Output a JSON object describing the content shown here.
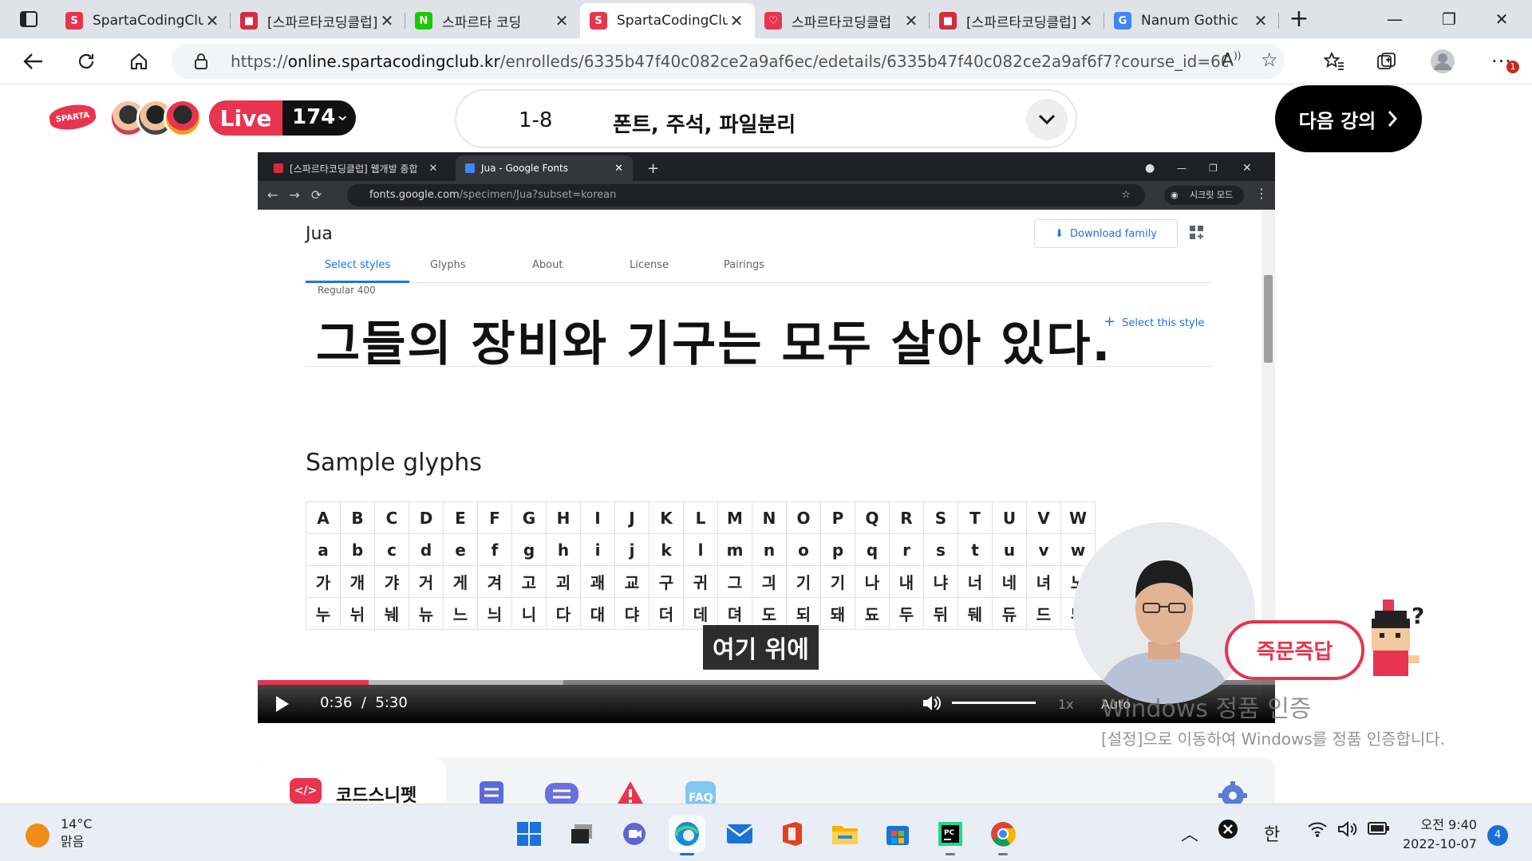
{
  "browser": {
    "tabs": [
      {
        "title": "SpartaCodingClub",
        "favicon_color": "#e8344e",
        "favicon_glyph": "S"
      },
      {
        "title": "[스파르타코딩클럽]",
        "favicon_color": "#d22d3d",
        "favicon_glyph": "■"
      },
      {
        "title": "스파르타 코딩",
        "favicon_color": "#1ec800",
        "favicon_glyph": "N"
      },
      {
        "title": "SpartaCodingClub",
        "favicon_color": "#e8344e",
        "favicon_glyph": "S"
      },
      {
        "title": "스파르타코딩클럽",
        "favicon_color": "#e8344e",
        "favicon_glyph": "♡"
      },
      {
        "title": "[스파르타코딩클럽]",
        "favicon_color": "#d22d3d",
        "favicon_glyph": "■"
      },
      {
        "title": "Nanum Gothic",
        "favicon_color": "#4285f4",
        "favicon_glyph": "G"
      }
    ],
    "active_tab_index": 3,
    "url_scheme": "https://",
    "url_host": "online.spartacodingclub.kr",
    "url_path": "/enrolleds/6335b47f40c082ce2a9af6ec/edetails/6335b47f40c082ce2a9af6f7?course_id=60a5ee42...",
    "menu_badge": "1"
  },
  "header": {
    "logo_text": "SPARTA",
    "live_label": "Live",
    "live_count": "174",
    "lesson_number": "1-8",
    "lesson_title": "폰트, 주석, 파일분리",
    "next_button": "다음 강의"
  },
  "video": {
    "inner_tabs": [
      {
        "title": "[스파르타코딩클럽] 웹개발 종합"
      },
      {
        "title": "Jua - Google Fonts"
      }
    ],
    "inner_url_host": "fonts.google.com",
    "inner_url_path": "/specimen/Jua?subset=korean",
    "incognito_label": "시크릿 모드",
    "gf": {
      "font_name": "Jua",
      "download_label": "Download family",
      "tabs": [
        "Select styles",
        "Glyphs",
        "About",
        "License",
        "Pairings"
      ],
      "style_label": "Regular 400",
      "specimen": "그들의 장비와 기구는 모두 살아 있다.",
      "select_style": "Select this style",
      "sample_glyphs_title": "Sample glyphs",
      "glyph_rows": [
        [
          "A",
          "B",
          "C",
          "D",
          "E",
          "F",
          "G",
          "H",
          "I",
          "J",
          "K",
          "L",
          "M",
          "N",
          "O",
          "P",
          "Q",
          "R",
          "S",
          "T",
          "U",
          "V",
          "W"
        ],
        [
          "a",
          "b",
          "c",
          "d",
          "e",
          "f",
          "g",
          "h",
          "i",
          "j",
          "k",
          "l",
          "m",
          "n",
          "o",
          "p",
          "q",
          "r",
          "s",
          "t",
          "u",
          "v",
          "w"
        ],
        [
          "가",
          "개",
          "갸",
          "거",
          "게",
          "겨",
          "고",
          "괴",
          "괘",
          "교",
          "구",
          "귀",
          "그",
          "긔",
          "기",
          "기",
          "나",
          "내",
          "냐",
          "너",
          "네",
          "녀",
          "노"
        ],
        [
          "누",
          "뉘",
          "눼",
          "뉴",
          "느",
          "늬",
          "니",
          "다",
          "대",
          "댜",
          "더",
          "데",
          "뎌",
          "도",
          "되",
          "돼",
          "됴",
          "두",
          "뒤",
          "뒈",
          "듀",
          "드",
          "듸"
        ]
      ]
    },
    "subtitle": "여기 위에",
    "current_time": "0:36",
    "duration": "5:30",
    "progress_fraction": 0.109,
    "buffer_fraction": 0.3,
    "volume_fraction": 1.0,
    "speed": "1x",
    "quality": "Auto"
  },
  "badge_label": "즉문즉답",
  "activation": {
    "title": "Windows 정품 인증",
    "body": "[설정]으로 이동하여 Windows를 정품 인증합니다."
  },
  "bottom_tabs": {
    "snippet_icon": "</>",
    "snippet_label": "코드스니펫"
  },
  "taskbar": {
    "temperature": "14°C",
    "weather": "맑음",
    "ime": "한",
    "time": "오전 9:40",
    "date": "2022-10-07",
    "notification_count": "4"
  }
}
